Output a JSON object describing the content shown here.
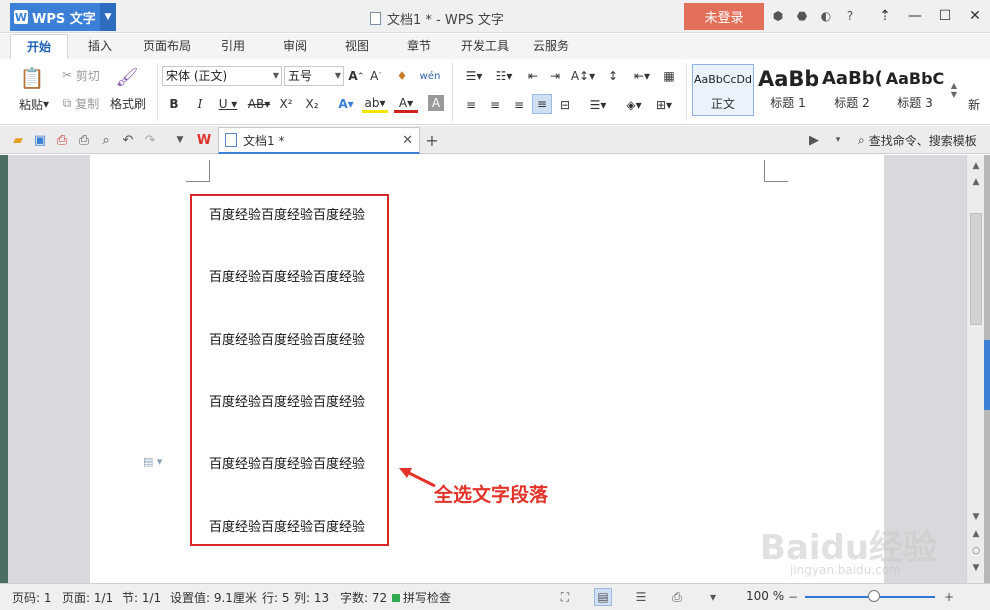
{
  "app": {
    "name": "WPS 文字",
    "window_title": "文档1 * - WPS 文字",
    "login_label": "未登录"
  },
  "tabs": [
    "开始",
    "插入",
    "页面布局",
    "引用",
    "审阅",
    "视图",
    "章节",
    "开发工具",
    "云服务"
  ],
  "ribbon": {
    "paste": "粘贴",
    "cut": "剪切",
    "copy": "复制",
    "format_painter": "格式刷",
    "font_name": "宋体 (正文)",
    "font_size": "五号",
    "styles": [
      {
        "sample": "AaBbCcDd",
        "caption": "正文"
      },
      {
        "sample": "AaBb",
        "caption": "标题 1"
      },
      {
        "sample": "AaBb(",
        "caption": "标题 2"
      },
      {
        "sample": "AaBbC",
        "caption": "标题 3"
      }
    ],
    "new_style": "新"
  },
  "doc_tab": {
    "title": "文档1 *"
  },
  "search_command": "查找命令、搜索模板",
  "document": {
    "lines": [
      "百度经验百度经验百度经验",
      "百度经验百度经验百度经验",
      "百度经验百度经验百度经验",
      "百度经验百度经验百度经验",
      "百度经验百度经验百度经验",
      "百度经验百度经验百度经验"
    ],
    "annotation": "全选文字段落"
  },
  "status": {
    "page": "页码: 1",
    "pages": "页面: 1/1",
    "section": "节: 1/1",
    "setting": "设置值: 9.1厘米",
    "row": "行: 5",
    "col": "列: 13",
    "word_count": "字数: 72",
    "spell": "拼写检查",
    "zoom": "100 %"
  },
  "watermark": {
    "main": "Baidu经验",
    "sub": "jingyan.baidu.com"
  },
  "colors": {
    "accent": "#3c7fd6",
    "login": "#e2705b",
    "selection_box": "#d92626"
  }
}
